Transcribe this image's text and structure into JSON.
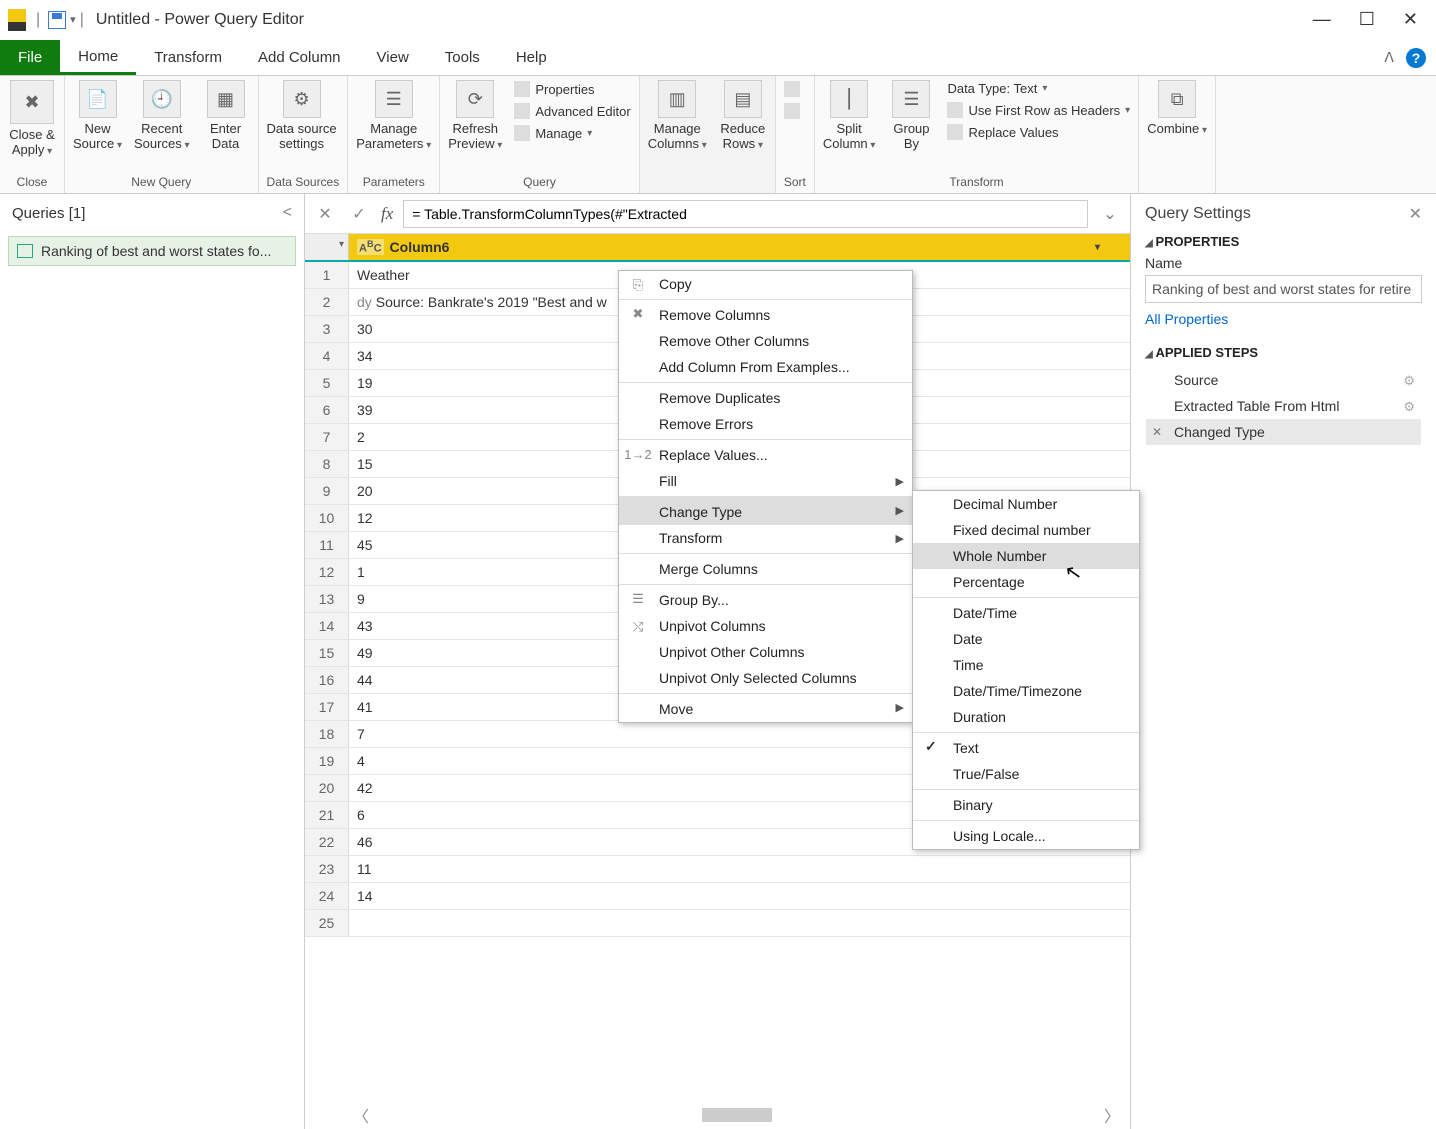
{
  "titlebar": {
    "title": "Untitled - Power Query Editor"
  },
  "winbtns": {
    "min": "—",
    "max": "☐",
    "close": "✕"
  },
  "tabs": {
    "file": "File",
    "home": "Home",
    "transform": "Transform",
    "addcol": "Add Column",
    "view": "View",
    "tools": "Tools",
    "help": "Help"
  },
  "ribbon": {
    "close": {
      "btn": "Close &\nApply",
      "label": "Close"
    },
    "newquery": {
      "new": "New\nSource",
      "recent": "Recent\nSources",
      "enter": "Enter\nData",
      "label": "New Query"
    },
    "ds": {
      "btn": "Data source\nsettings",
      "label": "Data Sources"
    },
    "param": {
      "btn": "Manage\nParameters",
      "label": "Parameters"
    },
    "query": {
      "refresh": "Refresh\nPreview",
      "props": "Properties",
      "adv": "Advanced Editor",
      "manage": "Manage",
      "label": "Query"
    },
    "mc": {
      "cols": "Manage\nColumns",
      "rows": "Reduce\nRows"
    },
    "sort": {
      "label": "Sort"
    },
    "trn": {
      "split": "Split\nColumn",
      "group": "Group\nBy",
      "dtype": "Data Type: Text",
      "first": "Use First Row as Headers",
      "replace": "Replace Values",
      "label": "Transform"
    },
    "combine": {
      "btn": "Combine"
    }
  },
  "queries": {
    "head": "Queries [1]",
    "item": "Ranking of best and worst states fo..."
  },
  "formula": "= Table.TransformColumnTypes(#\"Extracted",
  "grid": {
    "col": "Column6",
    "rows": [
      {
        "n": "1",
        "v": "Weather",
        "trunc": ""
      },
      {
        "n": "2",
        "v": "Source: Bankrate's 2019 \"Best and w",
        "trunc": "dy"
      },
      {
        "n": "3",
        "v": "30"
      },
      {
        "n": "4",
        "v": "34"
      },
      {
        "n": "5",
        "v": "19"
      },
      {
        "n": "6",
        "v": "39"
      },
      {
        "n": "7",
        "v": "2"
      },
      {
        "n": "8",
        "v": "15"
      },
      {
        "n": "9",
        "v": "20"
      },
      {
        "n": "10",
        "v": "12"
      },
      {
        "n": "11",
        "v": "45"
      },
      {
        "n": "12",
        "v": "1"
      },
      {
        "n": "13",
        "v": "9"
      },
      {
        "n": "14",
        "v": "43"
      },
      {
        "n": "15",
        "v": "49"
      },
      {
        "n": "16",
        "v": "44"
      },
      {
        "n": "17",
        "v": "41"
      },
      {
        "n": "18",
        "v": "7"
      },
      {
        "n": "19",
        "v": "4"
      },
      {
        "n": "20",
        "v": "42"
      },
      {
        "n": "21",
        "v": "6"
      },
      {
        "n": "22",
        "v": "46"
      },
      {
        "n": "23",
        "v": "11"
      },
      {
        "n": "24",
        "v": "14"
      },
      {
        "n": "25",
        "v": ""
      }
    ]
  },
  "settings": {
    "head": "Query Settings",
    "props": "PROPERTIES",
    "name": "Name",
    "nameval": "Ranking of best and worst states for retire",
    "all": "All Properties",
    "steps": "APPLIED STEPS",
    "s1": "Source",
    "s2": "Extracted Table From Html",
    "s3": "Changed Type"
  },
  "ctx1": {
    "copy": "Copy",
    "remc": "Remove Columns",
    "remo": "Remove Other Columns",
    "addc": "Add Column From Examples...",
    "remd": "Remove Duplicates",
    "reme": "Remove Errors",
    "repl": "Replace Values...",
    "fill": "Fill",
    "ctype": "Change Type",
    "trans": "Transform",
    "merge": "Merge Columns",
    "group": "Group By...",
    "unp": "Unpivot Columns",
    "unpo": "Unpivot Other Columns",
    "unps": "Unpivot Only Selected Columns",
    "move": "Move"
  },
  "ctx2": {
    "dec": "Decimal Number",
    "fix": "Fixed decimal number",
    "whole": "Whole Number",
    "pct": "Percentage",
    "dt": "Date/Time",
    "date": "Date",
    "time": "Time",
    "dtz": "Date/Time/Timezone",
    "dur": "Duration",
    "text": "Text",
    "tf": "True/False",
    "bin": "Binary",
    "loc": "Using Locale..."
  }
}
